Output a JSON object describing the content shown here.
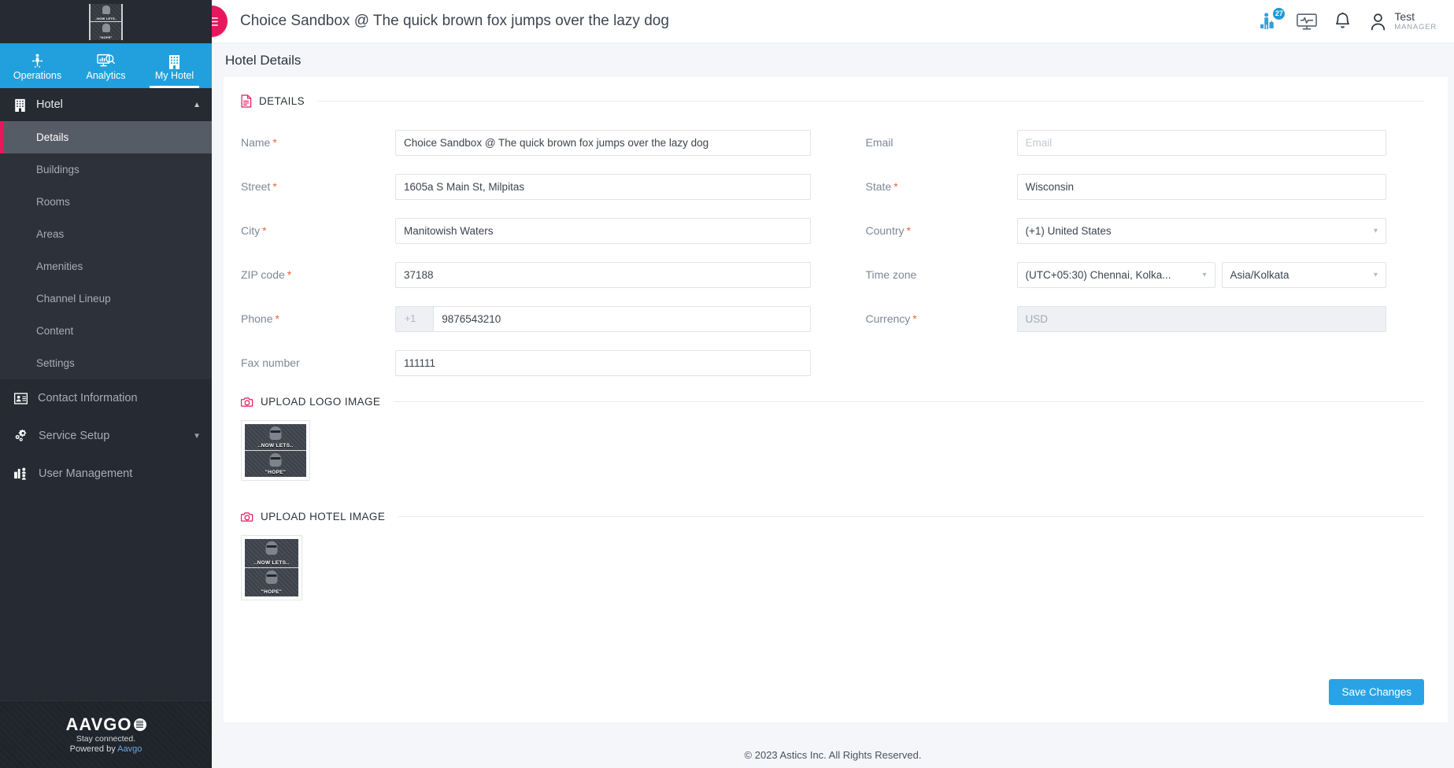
{
  "brand": {
    "accent_pink": "#e8175d",
    "accent_blue": "#22a0dd",
    "sidebar_bg": "#252a33",
    "save_blue": "#29a3e5"
  },
  "topnav": {
    "tabs": [
      {
        "label": "Operations",
        "icon": "operations-icon",
        "active": false
      },
      {
        "label": "Analytics",
        "icon": "analytics-icon",
        "active": false
      },
      {
        "label": "My Hotel",
        "icon": "building-icon",
        "active": true
      }
    ]
  },
  "sidebar": {
    "group": {
      "label": "Hotel",
      "icon": "building-icon",
      "chevron": "chevron-up-icon",
      "items": [
        {
          "label": "Details",
          "active": true
        },
        {
          "label": "Buildings",
          "active": false
        },
        {
          "label": "Rooms",
          "active": false
        },
        {
          "label": "Areas",
          "active": false
        },
        {
          "label": "Amenities",
          "active": false
        },
        {
          "label": "Channel Lineup",
          "active": false
        },
        {
          "label": "Content",
          "active": false
        },
        {
          "label": "Settings",
          "active": false
        }
      ]
    },
    "flat_items": [
      {
        "label": "Contact Information",
        "icon": "contact-card-icon",
        "chevron": ""
      },
      {
        "label": "Service Setup",
        "icon": "gear-icon",
        "chevron": "chevron-down-icon"
      },
      {
        "label": "User Management",
        "icon": "user-management-icon",
        "chevron": ""
      }
    ],
    "footer": {
      "wordmark": "AAVGO",
      "line1": "Stay connected.",
      "line2_prefix": "Powered by ",
      "line2_link": "Aavgo"
    }
  },
  "header": {
    "menu_icon": "hamburger-menu-icon",
    "title": "Choice Sandbox @ The quick brown fox jumps over the lazy dog",
    "icons": [
      {
        "name": "guest-icon",
        "badge": "27"
      },
      {
        "name": "monitor-pulse-icon",
        "badge": ""
      },
      {
        "name": "bell-icon",
        "badge": ""
      }
    ],
    "user": {
      "avatar": "user-avatar-icon",
      "name": "Test",
      "role": "MANAGER"
    }
  },
  "page": {
    "title": "Hotel Details",
    "details_section": {
      "icon": "document-icon",
      "label": "DETAILS"
    },
    "fields_left": [
      {
        "label": "Name",
        "required": true,
        "value": "Choice Sandbox @ The quick brown fox jumps over the lazy dog",
        "placeholder": "",
        "type": "text"
      },
      {
        "label": "Street",
        "required": true,
        "value": "1605a S Main St, Milpitas",
        "placeholder": "",
        "type": "text"
      },
      {
        "label": "City",
        "required": true,
        "value": "Manitowish Waters",
        "placeholder": "",
        "type": "text"
      },
      {
        "label": "ZIP code",
        "required": true,
        "value": "37188",
        "placeholder": "",
        "type": "text"
      },
      {
        "label": "Phone",
        "required": true,
        "value": "9876543210",
        "prefix": "+1",
        "placeholder": "",
        "type": "phone"
      },
      {
        "label": "Fax number",
        "required": false,
        "value": "111111",
        "placeholder": "",
        "type": "text"
      }
    ],
    "fields_right": [
      {
        "label": "Email",
        "required": false,
        "value": "",
        "placeholder": "Email",
        "type": "text"
      },
      {
        "label": "State",
        "required": true,
        "value": "Wisconsin",
        "placeholder": "",
        "type": "text"
      },
      {
        "label": "Country",
        "required": true,
        "value": "(+1) United States",
        "placeholder": "",
        "type": "select"
      },
      {
        "label": "Time zone",
        "required": false,
        "value": "(UTC+05:30) Chennai, Kolka...",
        "value2": "Asia/Kolkata",
        "type": "dual-select"
      },
      {
        "label": "Currency",
        "required": true,
        "value": "",
        "placeholder": "USD",
        "type": "disabled"
      }
    ],
    "upload_logo": {
      "icon": "camera-icon",
      "label": "UPLOAD LOGO IMAGE",
      "thumb_top": "..NOW LETS..",
      "thumb_bottom": "\"HOPE\""
    },
    "upload_hotel": {
      "icon": "camera-icon",
      "label": "UPLOAD HOTEL IMAGE",
      "thumb_top": "..NOW LETS..",
      "thumb_bottom": "\"HOPE\""
    },
    "save_label": "Save Changes",
    "copyright": "© 2023 Astics Inc. All Rights Reserved."
  }
}
